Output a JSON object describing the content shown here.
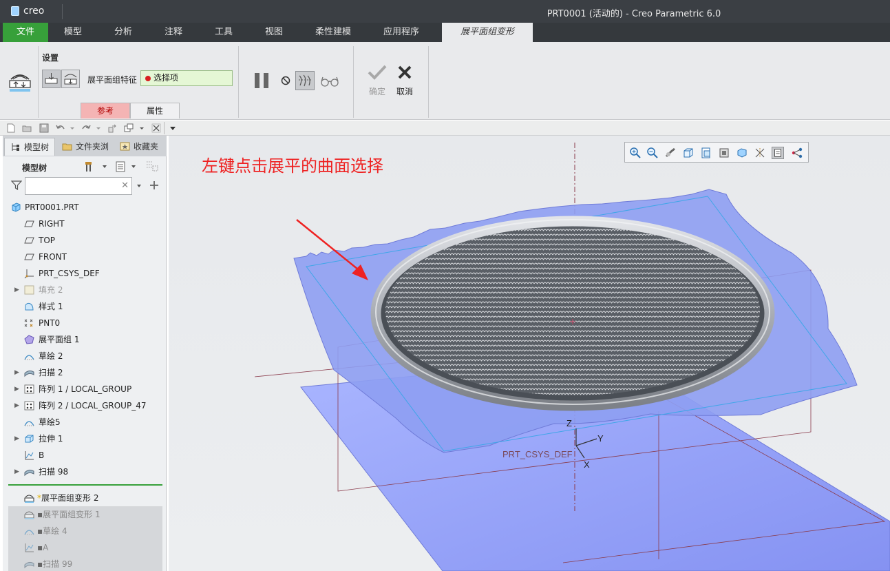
{
  "window": {
    "logo_text": "creo",
    "title": "PRT0001 (活动的) - Creo Parametric 6.0"
  },
  "menu": {
    "tabs": [
      {
        "label": "文件"
      },
      {
        "label": "模型"
      },
      {
        "label": "分析"
      },
      {
        "label": "注释"
      },
      {
        "label": "工具"
      },
      {
        "label": "视图"
      },
      {
        "label": "柔性建模"
      },
      {
        "label": "应用程序"
      },
      {
        "label": "展平面组变形"
      }
    ],
    "active_tab": "展平面组变形"
  },
  "ribbon": {
    "group_label": "设置",
    "feature_label": "展平面组特征",
    "collector_value": "选择项",
    "subtabs": {
      "reference": "参考",
      "properties": "属性"
    },
    "ok_label": "确定",
    "cancel_label": "取消"
  },
  "left_panel": {
    "tabs": {
      "model_tree": "模型树",
      "folder_browser": "文件夹浏",
      "favorites": "收藏夹"
    },
    "header": "模型树",
    "search": {
      "value": "",
      "placeholder": ""
    },
    "tree": [
      {
        "label": "PRT0001.PRT",
        "icon": "part-icon"
      },
      {
        "label": "RIGHT",
        "icon": "datum-plane-icon"
      },
      {
        "label": "TOP",
        "icon": "datum-plane-icon"
      },
      {
        "label": "FRONT",
        "icon": "datum-plane-icon"
      },
      {
        "label": "PRT_CSYS_DEF",
        "icon": "csys-icon"
      },
      {
        "label": "填充 2",
        "icon": "fill-icon",
        "expandable": true,
        "suppressed": true
      },
      {
        "label": "样式 1",
        "icon": "style-icon"
      },
      {
        "label": "PNT0",
        "icon": "datum-point-icon"
      },
      {
        "label": "展平面组 1",
        "icon": "flatten-quilt-icon"
      },
      {
        "label": "草绘 2",
        "icon": "sketch-icon"
      },
      {
        "label": "扫描 2",
        "icon": "sweep-icon",
        "expandable": true
      },
      {
        "label": "阵列 1 / LOCAL_GROUP",
        "icon": "pattern-icon",
        "expandable": true
      },
      {
        "label": "阵列 2 / LOCAL_GROUP_47",
        "icon": "pattern-icon",
        "expandable": true
      },
      {
        "label": "草绘5",
        "icon": "sketch-icon"
      },
      {
        "label": "拉伸 1",
        "icon": "extrude-icon",
        "expandable": true
      },
      {
        "label": "B",
        "icon": "datum-graph-icon"
      },
      {
        "label": "扫描 98",
        "icon": "sweep-icon",
        "expandable": true
      }
    ],
    "current_feature": {
      "label": "展平面组变形 2",
      "icon": "flatten-deform-icon"
    },
    "after_insert": [
      {
        "label": "展平面组变形 1",
        "icon": "flatten-deform-icon"
      },
      {
        "label": "草绘 4",
        "icon": "sketch-icon"
      },
      {
        "label": "A",
        "icon": "datum-graph-icon"
      },
      {
        "label": "扫描 99",
        "icon": "sweep-icon"
      }
    ]
  },
  "graphics": {
    "annotation": "左键点击展平的曲面选择",
    "annotation_color": "#ee2222",
    "surface_color": "#8ea0f0",
    "axis_labels": {
      "z": "Z",
      "y": "Y",
      "x": "X"
    },
    "csys_label": "PRT_CSYS_DEF"
  },
  "colors": {
    "file_tab": "#37a03a",
    "titlebar": "#3b3f44",
    "collector_bg": "#e5f7d5",
    "reference_tab": "#f4b4b4"
  }
}
